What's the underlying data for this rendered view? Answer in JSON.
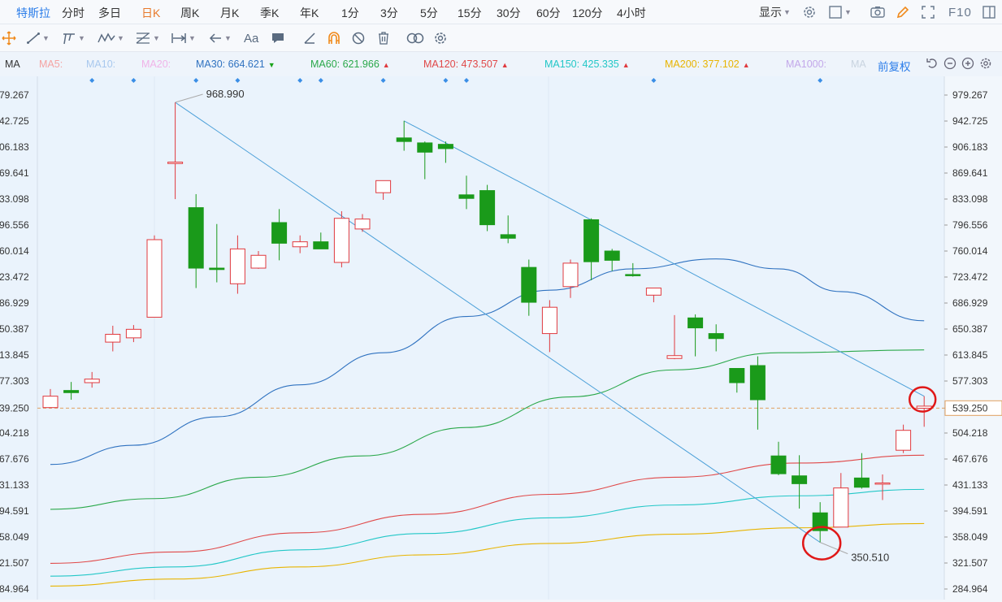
{
  "toolbar_top": {
    "symbol": "特斯拉",
    "periods": [
      "分时",
      "多日",
      "日K",
      "周K",
      "月K",
      "季K",
      "年K",
      "1分",
      "3分",
      "5分",
      "15分",
      "30分",
      "60分",
      "120分",
      "4小时"
    ],
    "active_period": "日K",
    "display_label": "显示",
    "f10_label": "F10"
  },
  "drawing_tools": {
    "text_tool_label": "Aa"
  },
  "ma_bar": {
    "title": "MA",
    "items": [
      {
        "label": "MA5:",
        "value": "",
        "color": "#f5a3a3",
        "trend": ""
      },
      {
        "label": "MA10:",
        "value": "",
        "color": "#a8c8ee",
        "trend": ""
      },
      {
        "label": "MA20:",
        "value": "",
        "color": "#f0b3e8",
        "trend": ""
      },
      {
        "label": "MA30: 664.621",
        "value": "664.621",
        "color": "#2f72c0",
        "trend": "down"
      },
      {
        "label": "MA60: 621.966",
        "value": "621.966",
        "color": "#2aa84a",
        "trend": "up"
      },
      {
        "label": "MA120: 473.507",
        "value": "473.507",
        "color": "#e04848",
        "trend": "up"
      },
      {
        "label": "MA150: 425.335",
        "value": "425.335",
        "color": "#22c7c7",
        "trend": "up"
      },
      {
        "label": "MA200: 377.102",
        "value": "377.102",
        "color": "#e8b400",
        "trend": "up"
      },
      {
        "label": "MA1000:",
        "value": "",
        "color": "#c3a8ea",
        "trend": ""
      },
      {
        "label": "MA",
        "value": "",
        "color": "#c9d4e0",
        "trend": ""
      }
    ],
    "adjust_label": "前复权"
  },
  "colors": {
    "up": "#e0393e",
    "down": "#1a9a1a",
    "trendline": "#4a9fd8",
    "current_price_line": "#e0a060",
    "highlight_circle": "#e01818",
    "marker": "#3a8ee6"
  },
  "chart_data": {
    "type": "candlestick",
    "yticks": [
      "979.267",
      "942.725",
      "906.183",
      "869.641",
      "833.098",
      "796.556",
      "760.014",
      "723.472",
      "686.929",
      "650.387",
      "613.845",
      "577.303",
      "539.250",
      "504.218",
      "467.676",
      "431.133",
      "394.591",
      "358.049",
      "321.507",
      "284.964"
    ],
    "ytick_values": [
      979.267,
      942.725,
      906.183,
      869.641,
      833.098,
      796.556,
      760.014,
      723.472,
      686.929,
      650.387,
      613.845,
      577.303,
      539.25,
      504.218,
      467.676,
      431.133,
      394.591,
      358.049,
      321.507,
      284.964
    ],
    "left_ytick_labels": [
      "79.267",
      "42.725",
      "06.183",
      "69.641",
      "33.098",
      "96.556",
      "60.014",
      "23.472",
      "86.929",
      "50.387",
      "13.845",
      "77.303",
      "39.250",
      "04.218",
      "67.676",
      "31.133",
      "94.591",
      "58.049",
      "21.507",
      "84.964"
    ],
    "current_price": "539.250",
    "current_price_value": 539.25,
    "annotations": [
      {
        "text": "968.990",
        "value": 968.99,
        "candle": 6
      },
      {
        "text": "350.510",
        "value": 350.51,
        "candle": 37
      }
    ],
    "candles": [
      {
        "o": 540,
        "h": 566,
        "l": 539,
        "c": 556
      },
      {
        "o": 564,
        "h": 576,
        "l": 551,
        "c": 561
      },
      {
        "o": 575,
        "h": 590,
        "l": 568,
        "c": 580
      },
      {
        "o": 632,
        "h": 655,
        "l": 619,
        "c": 643
      },
      {
        "o": 638,
        "h": 656,
        "l": 632,
        "c": 650
      },
      {
        "o": 667,
        "h": 782,
        "l": 667,
        "c": 776
      },
      {
        "o": 883,
        "h": 968.99,
        "l": 833,
        "c": 885
      },
      {
        "o": 821,
        "h": 840,
        "l": 708,
        "c": 736
      },
      {
        "o": 736,
        "h": 798,
        "l": 716,
        "c": 734
      },
      {
        "o": 714,
        "h": 782,
        "l": 700,
        "c": 763
      },
      {
        "o": 736,
        "h": 760,
        "l": 735,
        "c": 754
      },
      {
        "o": 800,
        "h": 819,
        "l": 747,
        "c": 771
      },
      {
        "o": 766,
        "h": 782,
        "l": 757,
        "c": 773
      },
      {
        "o": 773,
        "h": 786,
        "l": 764,
        "c": 763
      },
      {
        "o": 744,
        "h": 816,
        "l": 737,
        "c": 806
      },
      {
        "o": 791,
        "h": 812,
        "l": 787,
        "c": 805
      },
      {
        "o": 842,
        "h": 846,
        "l": 832,
        "c": 859
      },
      {
        "o": 919,
        "h": 943,
        "l": 901,
        "c": 914
      },
      {
        "o": 912,
        "h": 914,
        "l": 861,
        "c": 899
      },
      {
        "o": 910,
        "h": 914,
        "l": 884,
        "c": 904
      },
      {
        "o": 839,
        "h": 866,
        "l": 819,
        "c": 834
      },
      {
        "o": 845,
        "h": 853,
        "l": 788,
        "c": 797
      },
      {
        "o": 783,
        "h": 810,
        "l": 771,
        "c": 778
      },
      {
        "o": 737,
        "h": 748,
        "l": 669,
        "c": 688
      },
      {
        "o": 644,
        "h": 691,
        "l": 618,
        "c": 681
      },
      {
        "o": 710,
        "h": 748,
        "l": 694,
        "c": 743
      },
      {
        "o": 804,
        "h": 806,
        "l": 719,
        "c": 745
      },
      {
        "o": 760,
        "h": 763,
        "l": 732,
        "c": 747
      },
      {
        "o": 727,
        "h": 743,
        "l": 724,
        "c": 726
      },
      {
        "o": 698,
        "h": 707,
        "l": 688,
        "c": 708
      },
      {
        "o": 609,
        "h": 670,
        "l": 608,
        "c": 613
      },
      {
        "o": 666,
        "h": 671,
        "l": 612,
        "c": 652
      },
      {
        "o": 644,
        "h": 657,
        "l": 619,
        "c": 637
      },
      {
        "o": 595,
        "h": 595,
        "l": 561,
        "c": 575
      },
      {
        "o": 599,
        "h": 612,
        "l": 509,
        "c": 551
      },
      {
        "o": 472,
        "h": 492,
        "l": 445,
        "c": 447
      },
      {
        "o": 444,
        "h": 473,
        "l": 398,
        "c": 433
      },
      {
        "o": 392,
        "h": 407,
        "l": 350.51,
        "c": 367
      },
      {
        "o": 372,
        "h": 448,
        "l": 372,
        "c": 427
      },
      {
        "o": 441,
        "h": 476,
        "l": 426,
        "c": 428
      },
      {
        "o": 433,
        "h": 446,
        "l": 410,
        "c": 434
      },
      {
        "o": 480,
        "h": 516,
        "l": 476,
        "c": 508
      },
      {
        "o": 539,
        "h": 556,
        "l": 513,
        "c": 542
      }
    ],
    "ma_series": [
      {
        "name": "MA30",
        "color": "#2f72c0",
        "values": [
          {
            "i": 0,
            "v": 460
          },
          {
            "i": 4,
            "v": 487
          },
          {
            "i": 8,
            "v": 527
          },
          {
            "i": 12,
            "v": 572
          },
          {
            "i": 16,
            "v": 617
          },
          {
            "i": 20,
            "v": 668
          },
          {
            "i": 24,
            "v": 705
          },
          {
            "i": 28,
            "v": 735
          },
          {
            "i": 32,
            "v": 749
          },
          {
            "i": 35,
            "v": 735
          },
          {
            "i": 38,
            "v": 703
          },
          {
            "i": 42,
            "v": 662
          }
        ]
      },
      {
        "name": "MA60",
        "color": "#2aa84a",
        "values": [
          {
            "i": 0,
            "v": 397
          },
          {
            "i": 5,
            "v": 412
          },
          {
            "i": 10,
            "v": 442
          },
          {
            "i": 15,
            "v": 472
          },
          {
            "i": 20,
            "v": 512
          },
          {
            "i": 25,
            "v": 555
          },
          {
            "i": 30,
            "v": 593
          },
          {
            "i": 35,
            "v": 617
          },
          {
            "i": 42,
            "v": 621
          }
        ]
      },
      {
        "name": "MA120",
        "color": "#e04848",
        "values": [
          {
            "i": 0,
            "v": 321
          },
          {
            "i": 6,
            "v": 337
          },
          {
            "i": 12,
            "v": 364
          },
          {
            "i": 18,
            "v": 390
          },
          {
            "i": 24,
            "v": 418
          },
          {
            "i": 30,
            "v": 442
          },
          {
            "i": 36,
            "v": 462
          },
          {
            "i": 42,
            "v": 473
          }
        ]
      },
      {
        "name": "MA150",
        "color": "#22c7c7",
        "values": [
          {
            "i": 0,
            "v": 303
          },
          {
            "i": 6,
            "v": 316
          },
          {
            "i": 12,
            "v": 340
          },
          {
            "i": 18,
            "v": 363
          },
          {
            "i": 24,
            "v": 385
          },
          {
            "i": 30,
            "v": 403
          },
          {
            "i": 36,
            "v": 416
          },
          {
            "i": 42,
            "v": 425
          }
        ]
      },
      {
        "name": "MA200",
        "color": "#e8b400",
        "values": [
          {
            "i": 0,
            "v": 289
          },
          {
            "i": 6,
            "v": 299
          },
          {
            "i": 12,
            "v": 316
          },
          {
            "i": 18,
            "v": 333
          },
          {
            "i": 24,
            "v": 349
          },
          {
            "i": 30,
            "v": 362
          },
          {
            "i": 36,
            "v": 371
          },
          {
            "i": 42,
            "v": 377
          }
        ]
      }
    ],
    "trendlines": [
      {
        "from": {
          "i": 6,
          "v": 968.99
        },
        "to": {
          "i": 37,
          "v": 350.51
        }
      },
      {
        "from": {
          "i": 17,
          "v": 943
        },
        "to": {
          "i": 42,
          "v": 556
        }
      }
    ],
    "highlight_candles": [
      37,
      42
    ],
    "top_markers": [
      2,
      4,
      7,
      9,
      12,
      13,
      16,
      19,
      20,
      29,
      37
    ]
  }
}
